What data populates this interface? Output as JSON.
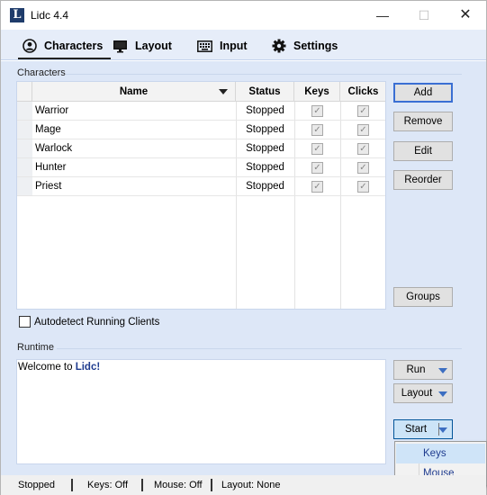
{
  "window": {
    "title": "Lidc 4.4",
    "icon_letter": "L",
    "minimize": "—",
    "maximize": "☐",
    "close": "✕"
  },
  "tabs": [
    {
      "label": "Characters",
      "icon": "user-circle-icon",
      "active": true
    },
    {
      "label": "Layout",
      "icon": "monitor-icon"
    },
    {
      "label": "Input",
      "icon": "keyboard-icon"
    },
    {
      "label": "Settings",
      "icon": "gear-icon"
    }
  ],
  "characters": {
    "group_label": "Characters",
    "columns": {
      "name": "Name",
      "status": "Status",
      "keys": "Keys",
      "clicks": "Clicks"
    },
    "rows": [
      {
        "name": "Warrior",
        "status": "Stopped",
        "keys": true,
        "clicks": true
      },
      {
        "name": "Mage",
        "status": "Stopped",
        "keys": true,
        "clicks": true
      },
      {
        "name": "Warlock",
        "status": "Stopped",
        "keys": true,
        "clicks": true
      },
      {
        "name": "Hunter",
        "status": "Stopped",
        "keys": true,
        "clicks": true
      },
      {
        "name": "Priest",
        "status": "Stopped",
        "keys": true,
        "clicks": true
      }
    ],
    "buttons": {
      "add": "Add",
      "remove": "Remove",
      "edit": "Edit",
      "reorder": "Reorder",
      "groups": "Groups"
    },
    "autodetect_label": "Autodetect Running Clients",
    "autodetect_checked": false
  },
  "runtime": {
    "group_label": "Runtime",
    "log_prefix": "Welcome to ",
    "log_app": "Lidc!",
    "run_button": "Run",
    "layout_button": "Layout",
    "start_button": "Start",
    "start_menu": [
      "Keys",
      "Mouse"
    ]
  },
  "statusbar": {
    "state": "Stopped",
    "keys": "Keys: Off",
    "mouse": "Mouse: Off",
    "layout": "Layout: None"
  },
  "colors": {
    "accent": "#3c6ec1",
    "panel": "#dde7f7",
    "tabbar": "#e6edf9",
    "link": "#1f3c8f"
  }
}
